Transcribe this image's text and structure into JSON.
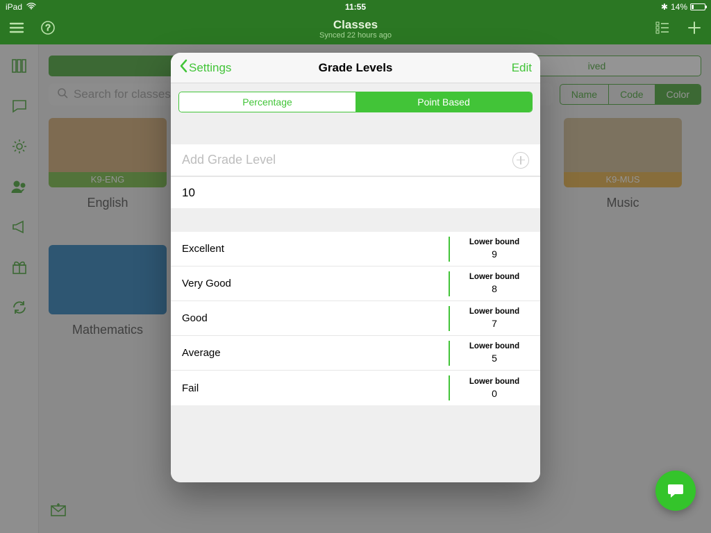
{
  "status": {
    "device": "iPad",
    "time": "11:55",
    "bt": "✱",
    "battery_pct": "14%"
  },
  "nav": {
    "title": "Classes",
    "subtitle": "Synced 22 hours ago"
  },
  "search": {
    "placeholder": "Search for classes"
  },
  "archived_label": "ived",
  "sort": {
    "o1": "Name",
    "o2": "Code",
    "o3": "Color"
  },
  "cards": {
    "english": {
      "code": "K9-ENG",
      "name": "English"
    },
    "music": {
      "code": "K9-MUS",
      "name": "Music"
    },
    "math": {
      "name": "Mathematics"
    }
  },
  "modal": {
    "back": "Settings",
    "title": "Grade Levels",
    "edit": "Edit",
    "seg": {
      "a": "Percentage",
      "b": "Point Based"
    },
    "add": "Add Grade Level",
    "max": "10",
    "lb_caption": "Lower bound",
    "rows": [
      {
        "label": "Excellent",
        "bound": "9"
      },
      {
        "label": "Very Good",
        "bound": "8"
      },
      {
        "label": "Good",
        "bound": "7"
      },
      {
        "label": "Average",
        "bound": "5"
      },
      {
        "label": "Fail",
        "bound": "0"
      }
    ]
  }
}
